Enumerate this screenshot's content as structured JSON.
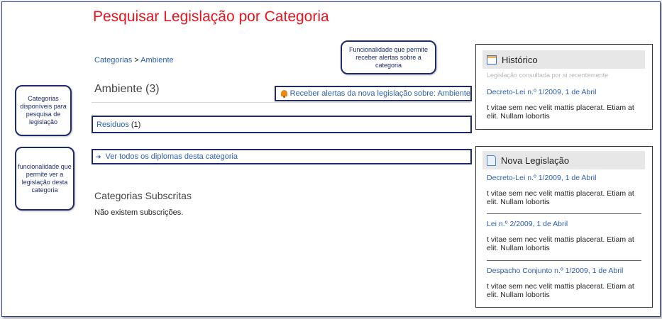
{
  "page": {
    "title": "Pesquisar Legislação por Categoria"
  },
  "breadcrumb": {
    "root": "Categorias",
    "separator": " > ",
    "current": "Ambiente"
  },
  "category": {
    "heading": "Ambiente (3)",
    "alert_link": "Receber alertas da nova legislação sobre: Ambiente",
    "alert_icon": "bell-icon",
    "subcategory_label": "Residuos",
    "subcategory_count": "(1)",
    "view_all_link": "Ver todos os diplomas desta categoria",
    "view_all_icon": "arrow-right-icon"
  },
  "subscriptions": {
    "heading": "Categorias Subscritas",
    "empty_text": "Não existem subscrições."
  },
  "callouts": {
    "alert": "Funcionalidade que permite receber alertas sobre a categoria",
    "categories": "Categorias disponíveis para pesquisa de legislação",
    "view_all": "funcionalidade que permite ver a legislação desta categoria"
  },
  "history_panel": {
    "title": "Histórico",
    "icon": "calendar-icon",
    "subtitle": "Legislação consultada por si recentemente",
    "items": [
      {
        "link": "Decreto-Lei n.º 1/2009, 1 de Abril",
        "text": "t vitae sem nec velit mattis placerat. Etiam at elit. Nullam lobortis"
      }
    ]
  },
  "new_panel": {
    "title": "Nova Legislação",
    "icon": "document-icon",
    "items": [
      {
        "link": "Decreto-Lei n.º 1/2009, 1 de Abril",
        "text": "t vitae sem nec velit mattis placerat. Etiam at elit. Nullam lobortis"
      },
      {
        "link": "Lei n.º 2/2009, 1 de Abril",
        "text": "t vitae sem nec velit mattis placerat. Etiam at elit. Nullam lobortis"
      },
      {
        "link": "Despacho Conjunto n.º 1/2009, 1 de Abril",
        "text": "t vitae sem nec velit mattis placerat. Etiam at elit. Nullam lobortis"
      }
    ]
  },
  "colors": {
    "title_red": "#e8141e",
    "link_blue": "#2a5fb0",
    "annotation_navy": "#1f2a6e"
  }
}
